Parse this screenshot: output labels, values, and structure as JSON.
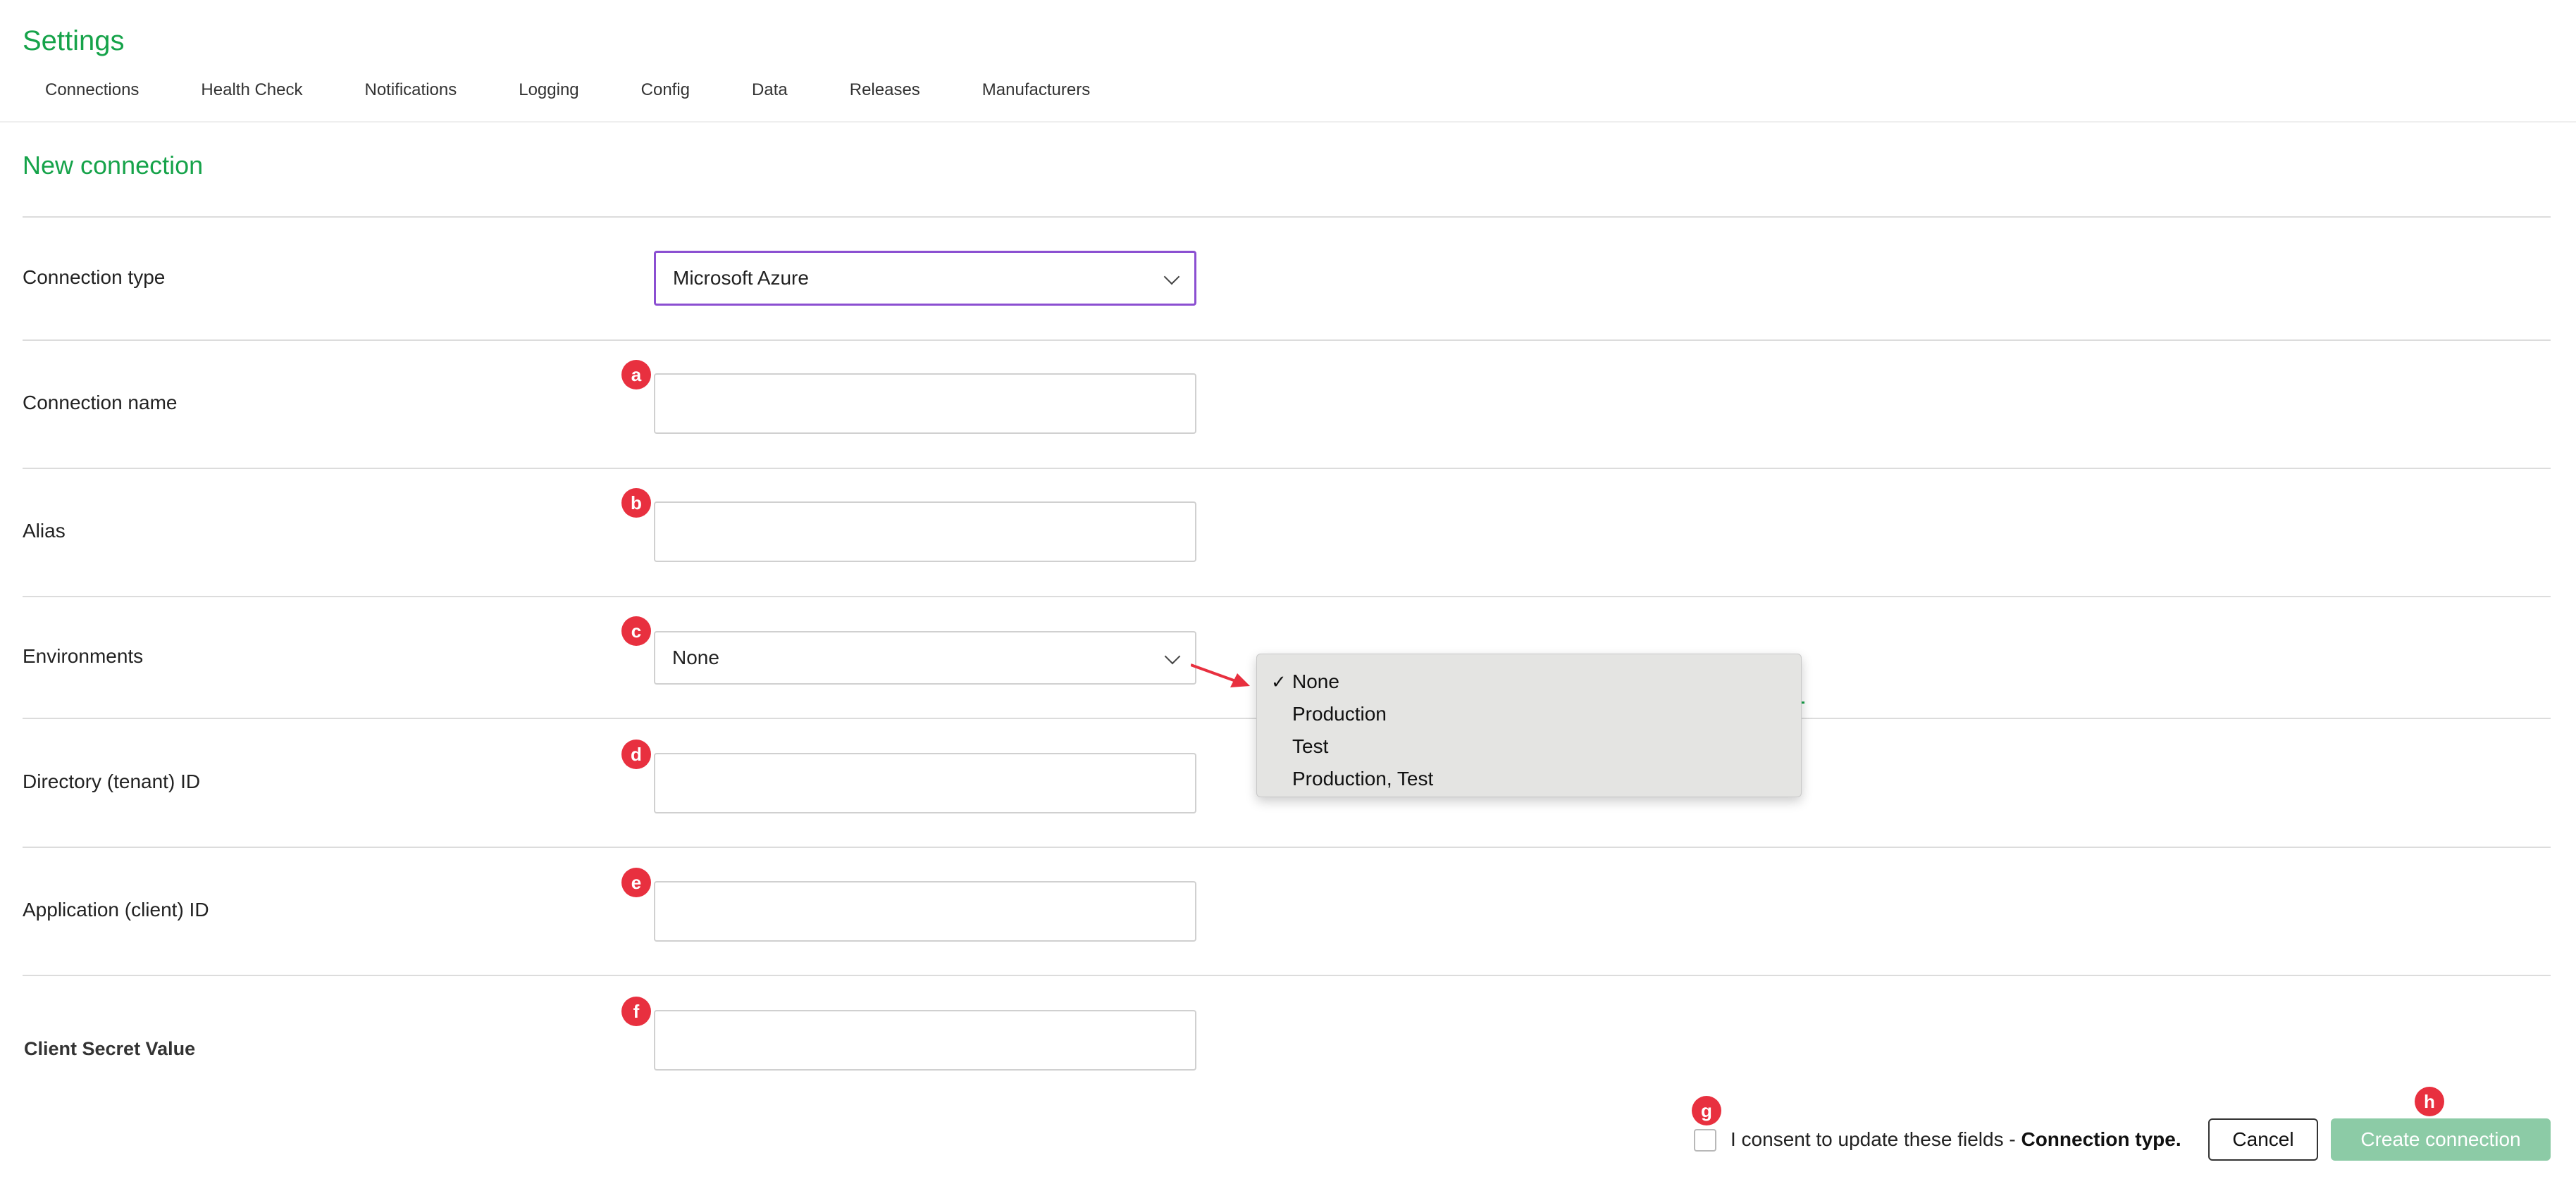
{
  "page": {
    "title": "Settings"
  },
  "tabs": [
    "Connections",
    "Health Check",
    "Notifications",
    "Logging",
    "Config",
    "Data",
    "Releases",
    "Manufacturers"
  ],
  "form": {
    "section_title": "New connection",
    "connection_type": {
      "label": "Connection type",
      "value": "Microsoft Azure"
    },
    "connection_name": {
      "label": "Connection name",
      "value": ""
    },
    "alias": {
      "label": "Alias",
      "value": ""
    },
    "environments": {
      "label": "Environments",
      "value": "None"
    },
    "directory_id": {
      "label": "Directory (tenant) ID",
      "value": ""
    },
    "application_id": {
      "label": "Application (client) ID",
      "value": ""
    },
    "client_secret": {
      "label": "Client Secret Value",
      "value": ""
    }
  },
  "dropdown": {
    "options": [
      "None",
      "Production",
      "Test",
      "Production, Test"
    ],
    "selected": "None",
    "check": "✓"
  },
  "markers": [
    "a",
    "b",
    "c",
    "d",
    "e",
    "f",
    "g",
    "h"
  ],
  "footer": {
    "consent_text": "I consent to update these fields - ",
    "consent_bold": "Connection type.",
    "cancel_label": "Cancel",
    "create_label": "Create connection"
  },
  "colors": {
    "accent": "#16a34a",
    "marker": "#e8303f",
    "create_disabled": "#8ccba6",
    "focus": "#8b4fd1"
  }
}
